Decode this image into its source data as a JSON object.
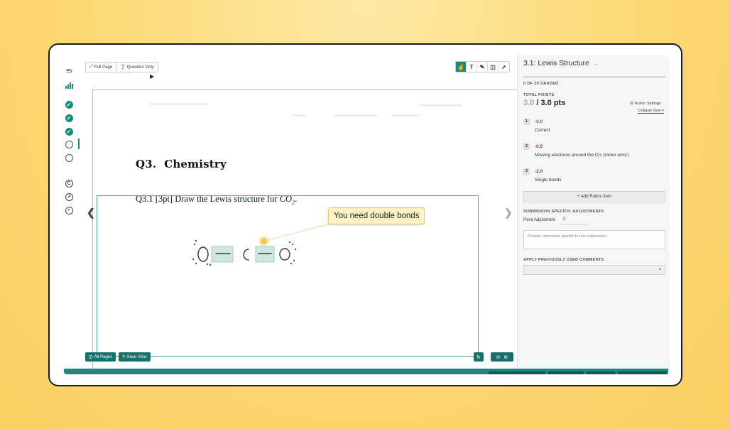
{
  "toolbar": {
    "full_page_label": "Full Page",
    "question_only_label": "Question Only",
    "tools": [
      "pointer",
      "text",
      "pen",
      "box",
      "pin"
    ]
  },
  "sidebar": {
    "icons": [
      "menu-icon",
      "stats-icon",
      "check-icon",
      "check-icon",
      "check-icon",
      "circle-icon",
      "circle-icon",
      "copyright-icon",
      "arrow-circle-icon",
      "target-icon"
    ]
  },
  "document": {
    "question_number": "Q3.",
    "question_title": "Chemistry",
    "prompt_text": "Q3.1 [3pt] Draw the Lewis structure for ",
    "prompt_formula": "CO",
    "prompt_subscript": "2",
    "prompt_end": ".",
    "comment_text": "You need double bonds"
  },
  "bottom_bar": {
    "all_pages_label": "All Pages",
    "save_view_label": "Save View"
  },
  "panel": {
    "title": "3.1: Lewis Structure",
    "graded_text": "0 OF 20 GRADED",
    "total_points_label": "TOTAL POINTS",
    "earned": "3.0",
    "total": " / 3.0 pts",
    "rubric_settings_label": "Rubric Settings",
    "collapse_view_label": "Collapse View",
    "rubric_items": [
      {
        "num": "1",
        "points": "-0.0",
        "desc": "Correct",
        "color": "#1a8a7e"
      },
      {
        "num": "2",
        "points": "-0.5",
        "desc": "Missing electrons around the O's (minor error)",
        "color": "#b3261e"
      },
      {
        "num": "3",
        "points": "-2.0",
        "desc": "Single bonds",
        "color": "#b3261e"
      }
    ],
    "add_rubric_label": "+ Add Rubric Item",
    "adjustments_label": "SUBMISSION SPECIFIC ADJUSTMENTS",
    "point_adjustment_label": "Point Adjustment",
    "point_adjustment_value": "0",
    "comments_placeholder": "Provide comments specific to this submission",
    "prev_comments_label": "APPLY PREVIOUSLY USED COMMENTS"
  },
  "colors": {
    "accent": "#1a8a7e",
    "background": "#fcd873",
    "comment": "#fdf3c7"
  }
}
